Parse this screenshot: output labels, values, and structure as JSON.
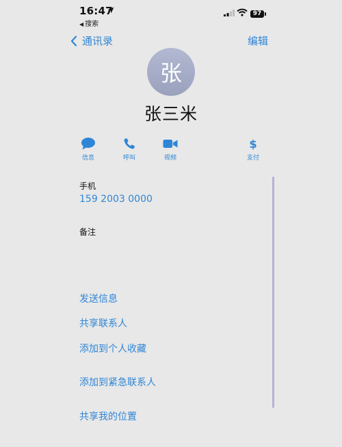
{
  "status_bar": {
    "time": "16:47",
    "back_app": "搜索",
    "battery": "97"
  },
  "nav": {
    "back_label": "通讯录",
    "edit_label": "编辑"
  },
  "contact": {
    "avatar_initial": "张",
    "name": "张三米"
  },
  "actions": [
    {
      "label": "信息",
      "icon": "message-icon"
    },
    {
      "label": "呼叫",
      "icon": "phone-icon"
    },
    {
      "label": "视频",
      "icon": "video-icon"
    },
    {
      "label": "支付",
      "icon": "dollar-icon"
    }
  ],
  "phone": {
    "label": "手机",
    "number": "159 2003 0000"
  },
  "notes": {
    "label": "备注"
  },
  "links": [
    {
      "label": "发送信息"
    },
    {
      "label": "共享联系人"
    },
    {
      "label": "添加到个人收藏"
    },
    {
      "label": "添加到紧急联系人"
    },
    {
      "label": "共享我的位置"
    }
  ],
  "colors": {
    "accent": "#2f86d6",
    "background": "#e8e8e8",
    "avatar": "#a8aec8",
    "scrollbar": "#b5b1d6"
  }
}
